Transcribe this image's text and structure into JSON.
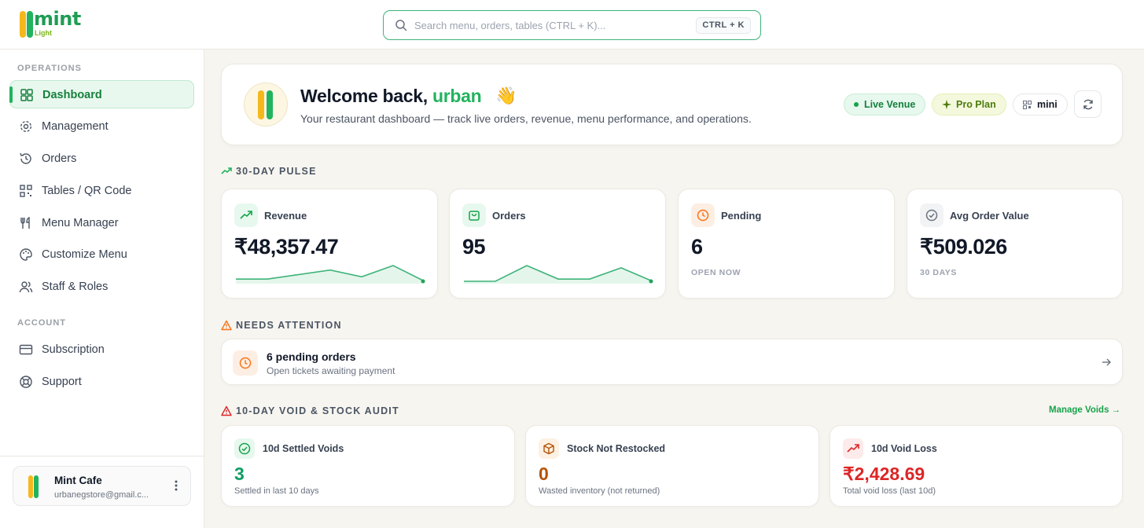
{
  "brand": {
    "name": "mint",
    "sub": "Light"
  },
  "search": {
    "placeholder": "Search menu, orders, tables (CTRL + K)...",
    "shortcut": "CTRL + K"
  },
  "sidebar": {
    "sections": [
      {
        "title": "OPERATIONS",
        "items": [
          {
            "label": "Dashboard",
            "icon": "dashboard-icon",
            "active": true
          },
          {
            "label": "Management",
            "icon": "gear-icon"
          },
          {
            "label": "Orders",
            "icon": "history-icon"
          },
          {
            "label": "Tables / QR Code",
            "icon": "qr-code-icon"
          },
          {
            "label": "Menu Manager",
            "icon": "utensils-icon"
          },
          {
            "label": "Customize Menu",
            "icon": "palette-icon"
          },
          {
            "label": "Staff & Roles",
            "icon": "users-icon"
          }
        ]
      },
      {
        "title": "ACCOUNT",
        "items": [
          {
            "label": "Subscription",
            "icon": "credit-card-icon"
          },
          {
            "label": "Support",
            "icon": "lifebuoy-icon"
          }
        ]
      }
    ],
    "profile": {
      "name": "Mint Cafe",
      "email": "urbanegstore@gmail.c..."
    }
  },
  "welcome": {
    "greeting": "Welcome back, ",
    "username": "urban",
    "emoji": "👋",
    "subtitle": "Your restaurant dashboard — track live orders, revenue, menu performance, and operations.",
    "badges": {
      "live": "Live Venue",
      "plan": "Pro Plan",
      "venue": "mini"
    }
  },
  "pulse": {
    "title": "30-DAY PULSE",
    "cards": [
      {
        "label": "Revenue",
        "value": "₹48,357.47",
        "icon": "trend-up-icon",
        "spark": [
          2,
          2,
          4,
          6,
          3,
          8,
          1
        ]
      },
      {
        "label": "Orders",
        "value": "95",
        "icon": "shopping-bag-icon",
        "spark": [
          1,
          1,
          8,
          2,
          2,
          7,
          1
        ]
      },
      {
        "label": "Pending",
        "value": "6",
        "caption": "OPEN NOW",
        "icon": "clock-icon"
      },
      {
        "label": "Avg Order Value",
        "value": "₹509.026",
        "caption": "30 DAYS",
        "icon": "check-circle-icon"
      }
    ]
  },
  "attention": {
    "title": "NEEDS ATTENTION",
    "item": {
      "title": "6 pending orders",
      "subtitle": "Open tickets awaiting payment"
    }
  },
  "audit": {
    "title": "10-DAY VOID & STOCK AUDIT",
    "action": "Manage Voids →",
    "cards": [
      {
        "label": "10d Settled Voids",
        "value": "3",
        "caption": "Settled in last 10 days",
        "color": "#0f9d63"
      },
      {
        "label": "Stock Not Restocked",
        "value": "0",
        "caption": "Wasted inventory (not returned)",
        "color": "#b45309"
      },
      {
        "label": "10d Void Loss",
        "value": "₹2,428.69",
        "caption": "Total void loss (last 10d)",
        "color": "#dc2626"
      }
    ]
  },
  "colors": {
    "accent": "#22b35e",
    "brand_yellow": "#f5b81c",
    "warning": "#f97316",
    "danger": "#dc2626"
  }
}
